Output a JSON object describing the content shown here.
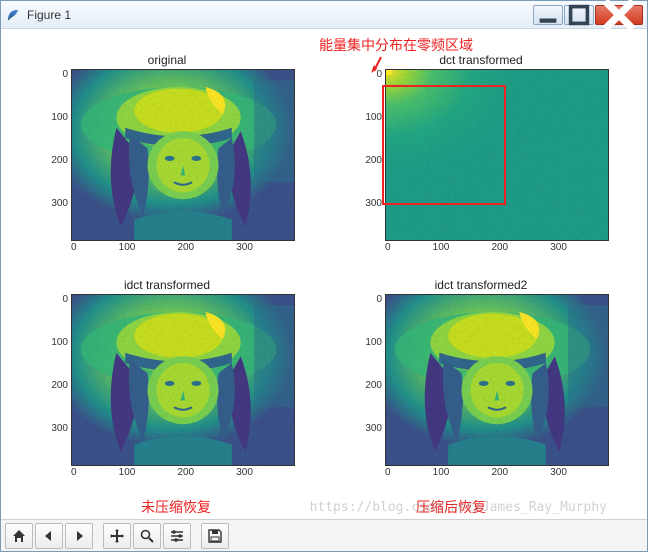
{
  "window": {
    "title": "Figure 1"
  },
  "annotations": {
    "top": "能量集中分布在零频区域",
    "bottom_left": "未压缩恢复",
    "bottom_right": "压缩后恢复"
  },
  "subplots": [
    {
      "id": "tl",
      "title": "original"
    },
    {
      "id": "tr",
      "title": "dct transformed"
    },
    {
      "id": "bl",
      "title": "idct transformed"
    },
    {
      "id": "br",
      "title": "idct transformed2"
    }
  ],
  "axis_ticks": {
    "x": [
      "0",
      "100",
      "200",
      "300"
    ],
    "y": [
      "0",
      "100",
      "200",
      "300"
    ]
  },
  "toolbar": {
    "home": "home",
    "back": "back",
    "forward": "forward",
    "pan": "pan",
    "zoom": "zoom",
    "subplots": "configure-subplots",
    "save": "save"
  },
  "watermark": "https://blog.csdn.net/James_Ray_Murphy",
  "chart_data": [
    {
      "type": "heatmap",
      "title": "original",
      "xlabel": "",
      "ylabel": "",
      "xlim": [
        0,
        384
      ],
      "ylim": [
        384,
        0
      ],
      "colormap": "viridis",
      "description": "Lena grayscale image displayed as viridis heatmap, 384x384"
    },
    {
      "type": "heatmap",
      "title": "dct transformed",
      "xlabel": "",
      "ylabel": "",
      "xlim": [
        0,
        384
      ],
      "ylim": [
        384,
        0
      ],
      "colormap": "viridis",
      "description": "2D DCT magnitude of Lena; energy concentrated in top-left ~200x200 low-frequency region (highlighted), rest near-uniform low values"
    },
    {
      "type": "heatmap",
      "title": "idct transformed",
      "xlabel": "",
      "ylabel": "",
      "xlim": [
        0,
        384
      ],
      "ylim": [
        384,
        0
      ],
      "colormap": "viridis",
      "description": "Inverse DCT without compression — reconstruction matches original Lena"
    },
    {
      "type": "heatmap",
      "title": "idct transformed2",
      "xlabel": "",
      "ylabel": "",
      "xlim": [
        0,
        384
      ],
      "ylim": [
        384,
        0
      ],
      "colormap": "viridis",
      "description": "Inverse DCT after discarding high-frequency coefficients — compressed reconstruction of Lena"
    }
  ]
}
